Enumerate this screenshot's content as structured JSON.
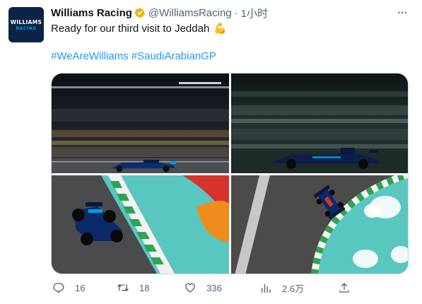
{
  "avatar": {
    "logo_main": "WILLIAMS",
    "logo_sub": "RACING"
  },
  "author": {
    "name": "Williams Racing",
    "handle": "@WilliamsRacing",
    "separator": "·",
    "time": "1小时"
  },
  "tweet": {
    "text": "Ready for our third visit to Jeddah",
    "emoji": "💪",
    "hashtags": [
      "#WeAreWilliams",
      "#SaudiArabianGP"
    ]
  },
  "media": {
    "photos": [
      {
        "subject": "night-track-motion-blur"
      },
      {
        "subject": "car-speed-blur"
      },
      {
        "subject": "car-cornering-kerb"
      },
      {
        "subject": "aerial-car-corner"
      }
    ]
  },
  "actions": {
    "reply_count": "16",
    "retweet_count": "18",
    "like_count": "336",
    "views_count": "2.6万"
  },
  "colors": {
    "accent": "#1d9bf0",
    "secondary_text": "#536471",
    "verified_badge": "#e2b719",
    "avatar_bg": "#0b2347"
  },
  "icons": [
    "verified-badge-icon",
    "more-icon",
    "reply-icon",
    "retweet-icon",
    "like-icon",
    "views-icon",
    "share-icon"
  ]
}
